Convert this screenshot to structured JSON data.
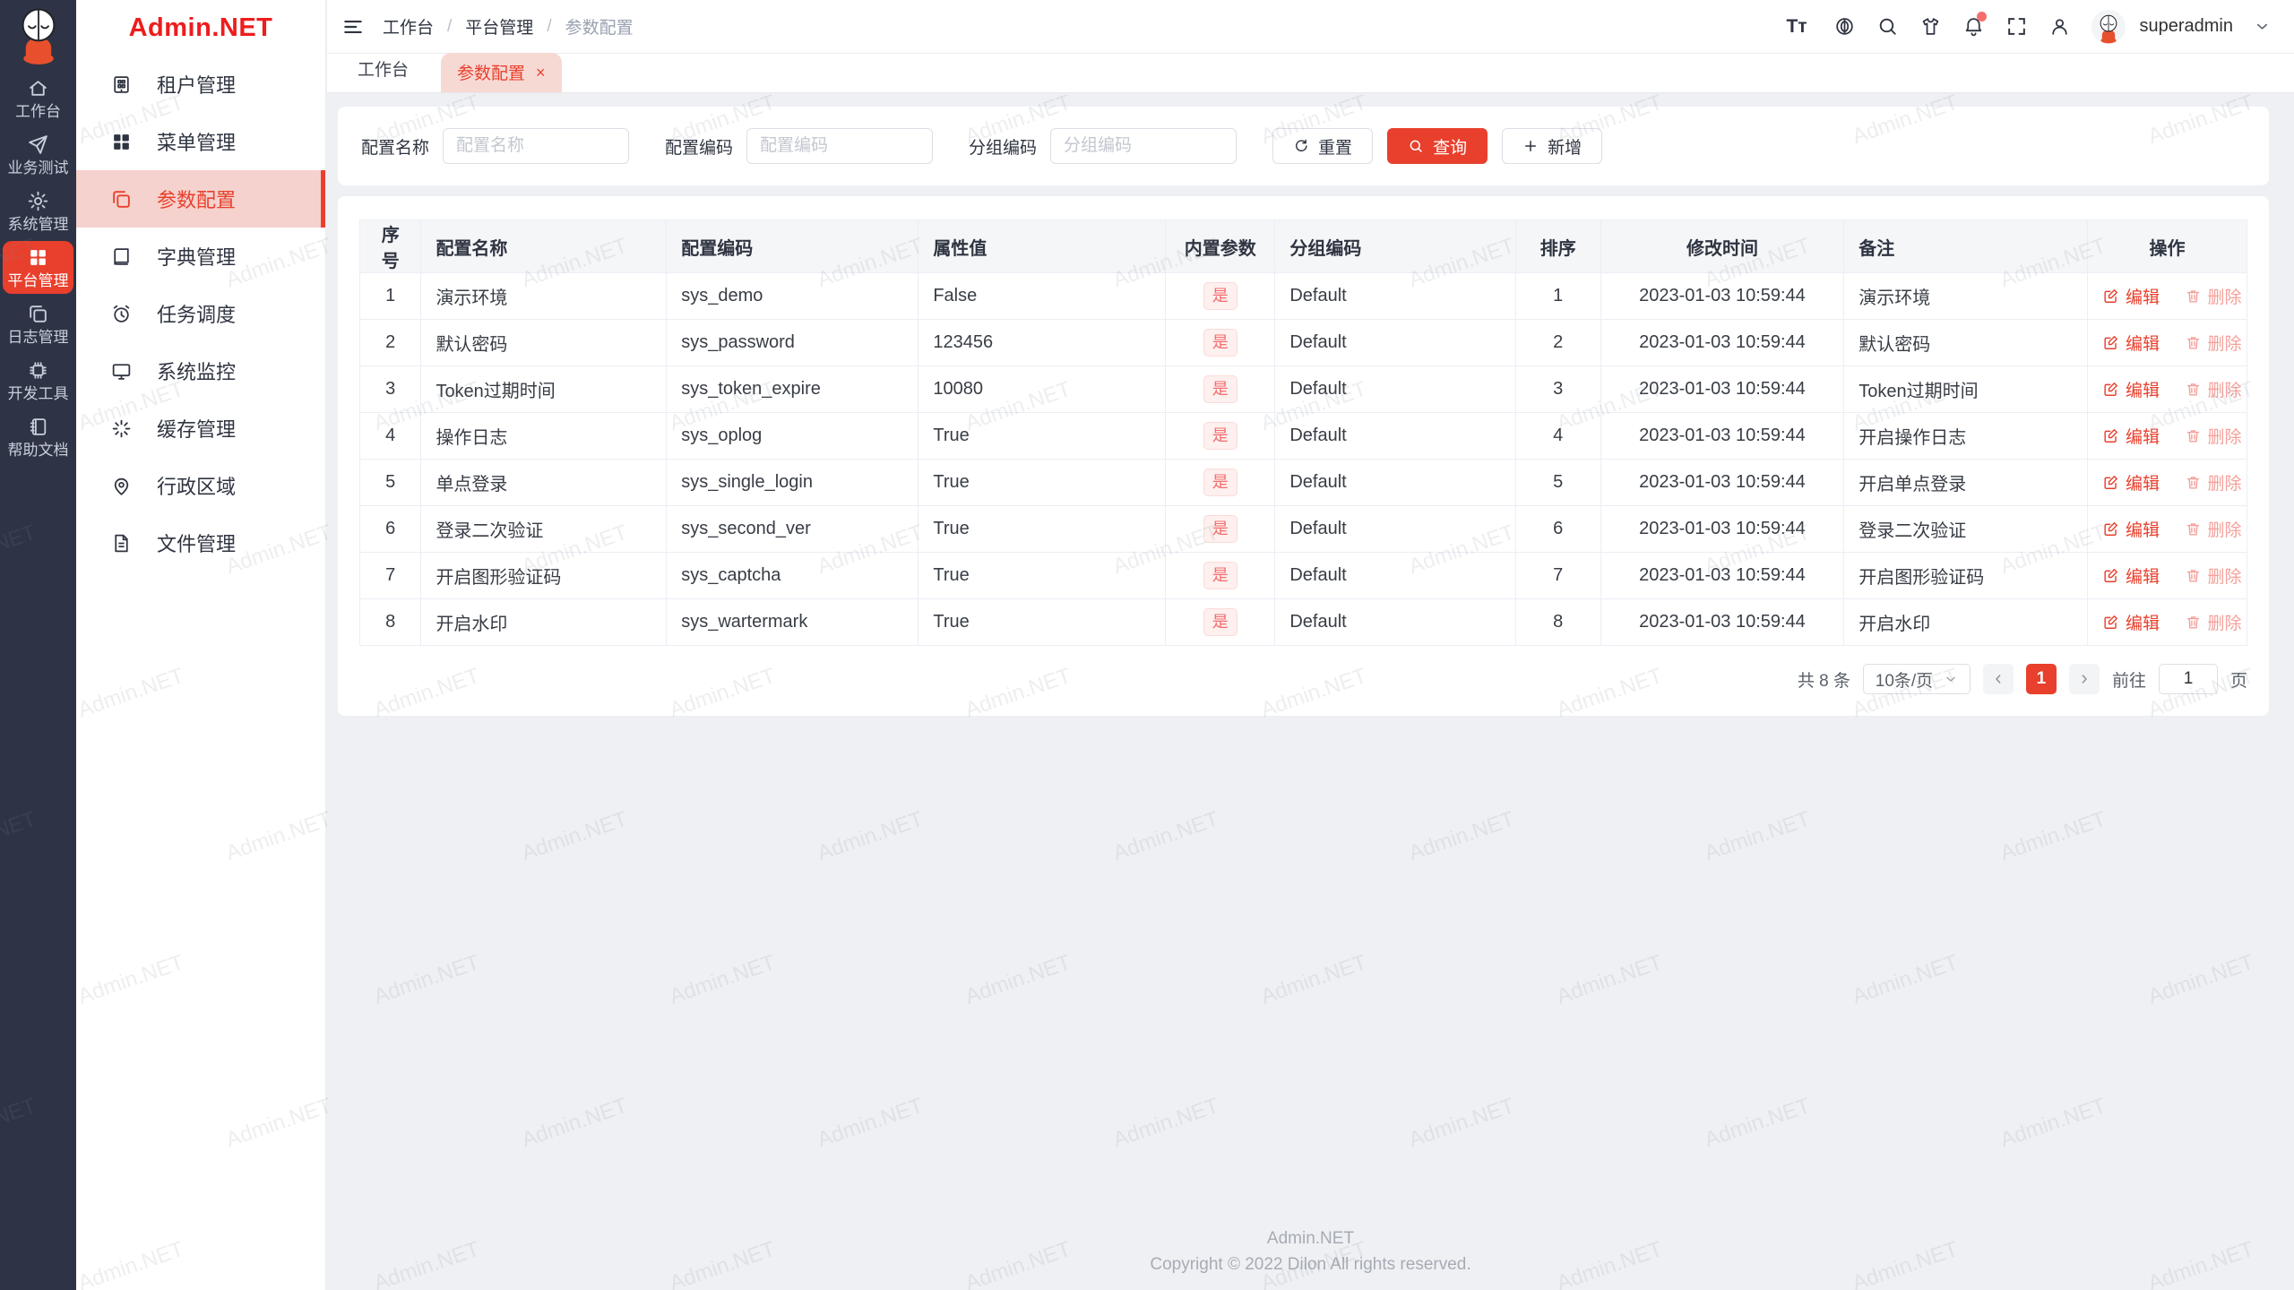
{
  "app_title": "Admin.NET",
  "rail": {
    "items": [
      {
        "label": "工作台",
        "active": false
      },
      {
        "label": "业务测试",
        "active": false
      },
      {
        "label": "系统管理",
        "active": false
      },
      {
        "label": "平台管理",
        "active": true
      },
      {
        "label": "日志管理",
        "active": false
      },
      {
        "label": "开发工具",
        "active": false
      },
      {
        "label": "帮助文档",
        "active": false
      }
    ]
  },
  "sidebar": {
    "logo": "Admin.NET",
    "items": [
      {
        "label": "租户管理",
        "active": false
      },
      {
        "label": "菜单管理",
        "active": false
      },
      {
        "label": "参数配置",
        "active": true
      },
      {
        "label": "字典管理",
        "active": false
      },
      {
        "label": "任务调度",
        "active": false
      },
      {
        "label": "系统监控",
        "active": false
      },
      {
        "label": "缓存管理",
        "active": false
      },
      {
        "label": "行政区域",
        "active": false
      },
      {
        "label": "文件管理",
        "active": false
      }
    ]
  },
  "topbar": {
    "breadcrumb": {
      "items": [
        "工作台",
        "平台管理",
        "参数配置"
      ],
      "separator": "/"
    },
    "font_icon_text": "Tт",
    "username": "superadmin"
  },
  "tabs": [
    {
      "label": "工作台"
    },
    {
      "label": "参数配置",
      "close": "×"
    }
  ],
  "search": {
    "fields": [
      {
        "label": "配置名称",
        "placeholder": "配置名称"
      },
      {
        "label": "配置编码",
        "placeholder": "配置编码"
      },
      {
        "label": "分组编码",
        "placeholder": "分组编码"
      }
    ],
    "reset": "重置",
    "query": "查询",
    "add": "新增"
  },
  "table": {
    "columns": [
      "序号",
      "配置名称",
      "配置编码",
      "属性值",
      "内置参数",
      "分组编码",
      "排序",
      "修改时间",
      "备注",
      "操作"
    ],
    "actions": {
      "edit": "编辑",
      "delete": "删除"
    },
    "rows": [
      {
        "no": "1",
        "name": "演示环境",
        "code": "sys_demo",
        "value": "False",
        "builtin": "是",
        "group": "Default",
        "sort": "1",
        "time": "2023-01-03 10:59:44",
        "remark": "演示环境"
      },
      {
        "no": "2",
        "name": "默认密码",
        "code": "sys_password",
        "value": "123456",
        "builtin": "是",
        "group": "Default",
        "sort": "2",
        "time": "2023-01-03 10:59:44",
        "remark": "默认密码"
      },
      {
        "no": "3",
        "name": "Token过期时间",
        "code": "sys_token_expire",
        "value": "10080",
        "builtin": "是",
        "group": "Default",
        "sort": "3",
        "time": "2023-01-03 10:59:44",
        "remark": "Token过期时间"
      },
      {
        "no": "4",
        "name": "操作日志",
        "code": "sys_oplog",
        "value": "True",
        "builtin": "是",
        "group": "Default",
        "sort": "4",
        "time": "2023-01-03 10:59:44",
        "remark": "开启操作日志"
      },
      {
        "no": "5",
        "name": "单点登录",
        "code": "sys_single_login",
        "value": "True",
        "builtin": "是",
        "group": "Default",
        "sort": "5",
        "time": "2023-01-03 10:59:44",
        "remark": "开启单点登录"
      },
      {
        "no": "6",
        "name": "登录二次验证",
        "code": "sys_second_ver",
        "value": "True",
        "builtin": "是",
        "group": "Default",
        "sort": "6",
        "time": "2023-01-03 10:59:44",
        "remark": "登录二次验证"
      },
      {
        "no": "7",
        "name": "开启图形验证码",
        "code": "sys_captcha",
        "value": "True",
        "builtin": "是",
        "group": "Default",
        "sort": "7",
        "time": "2023-01-03 10:59:44",
        "remark": "开启图形验证码"
      },
      {
        "no": "8",
        "name": "开启水印",
        "code": "sys_wartermark",
        "value": "True",
        "builtin": "是",
        "group": "Default",
        "sort": "8",
        "time": "2023-01-03 10:59:44",
        "remark": "开启水印"
      }
    ]
  },
  "pagination": {
    "total": "共 8 条",
    "page_size": "10条/页",
    "page": "1",
    "goto": "前往",
    "goto_value": "1",
    "unit": "页"
  },
  "footer": {
    "line1": "Admin.NET",
    "line2": "Copyright © 2022 Dilon All rights reserved."
  },
  "watermark": {
    "text": "Admin.NET"
  },
  "colors": {
    "primary": "#e8402d",
    "logo_red": "#ee1c1c",
    "rail_bg": "#2e3446",
    "active_bg": "#f5d2cd",
    "tag_text": "#f56c6c",
    "tag_bg": "#fdf0ef"
  }
}
